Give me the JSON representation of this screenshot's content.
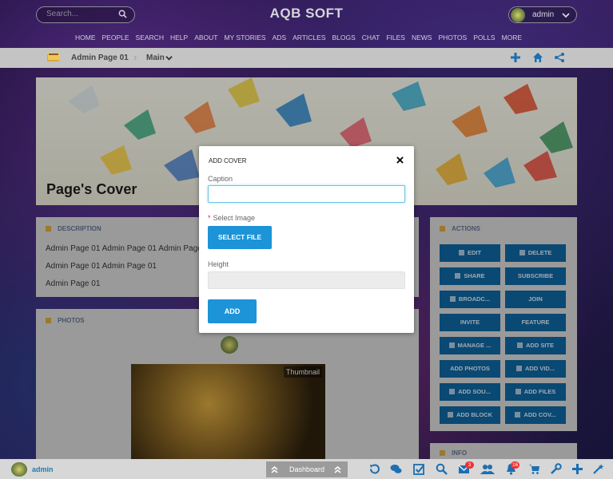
{
  "header": {
    "search_placeholder": "Search...",
    "brand": "AQB SOFT",
    "user": "admin",
    "nav": [
      "HOME",
      "PEOPLE",
      "SEARCH",
      "HELP",
      "ABOUT",
      "MY STORIES",
      "ADS",
      "ARTICLES",
      "BLOGS",
      "CHAT",
      "FILES",
      "NEWS",
      "PHOTOS",
      "POLLS",
      "MORE"
    ]
  },
  "breadcrumb": {
    "page": "Admin Page 01",
    "section": "Main"
  },
  "cover": {
    "title": "Page's Cover"
  },
  "description": {
    "heading": "DESCRIPTION",
    "lines": [
      "Admin Page 01 Admin Page 01 Admin Page",
      "Admin Page 01 Admin Page 01",
      "Admin Page 01"
    ]
  },
  "photos": {
    "heading": "PHOTOS",
    "thumb_label": "Thumbnail"
  },
  "actions": {
    "heading": "ACTIONS",
    "buttons": [
      "EDIT",
      "DELETE",
      "SHARE",
      "SUBSCRIBE",
      "BROADC...",
      "JOIN",
      "INVITE",
      "FEATURE",
      "MANAGE ...",
      "ADD SITE",
      "ADD PHOTOS",
      "ADD VID...",
      "ADD SOU...",
      "ADD FILES",
      "ADD BLOCK",
      "ADD COV..."
    ]
  },
  "info": {
    "heading": "INFO"
  },
  "modal": {
    "title": "ADD COVER",
    "caption_label": "Caption",
    "caption_value": "",
    "image_label": "Select Image",
    "select_file_label": "SELECT FILE",
    "height_label": "Height",
    "height_value": "",
    "add_label": "ADD"
  },
  "bottom": {
    "user": "admin",
    "dashboard": "Dashboard",
    "mail_count": "3",
    "notif_count": "16"
  },
  "colors": {
    "accent": "#1c94d7",
    "dim_button": "#0e5e94",
    "badge": "#e33333"
  }
}
